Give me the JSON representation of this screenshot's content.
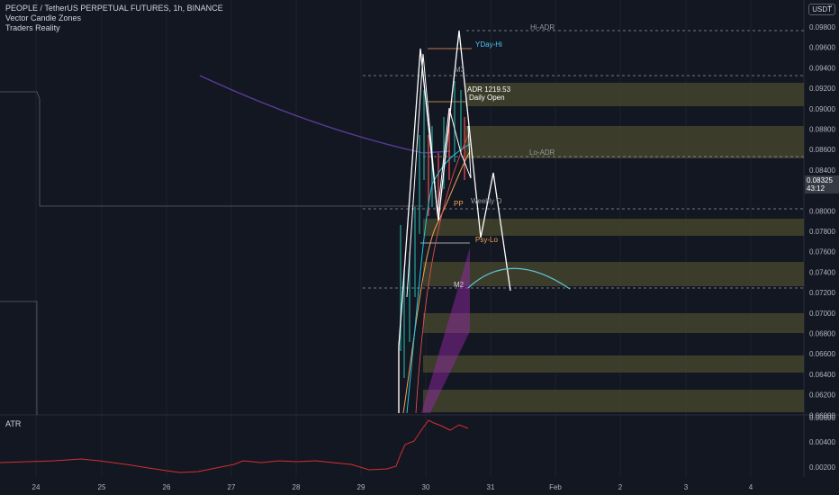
{
  "legend": {
    "symbol_line": "PEOPLE / TetherUS PERPETUAL FUTURES, 1h, BINANCE",
    "indicator_1": "Vector Candle Zones",
    "indicator_2": "Traders Reality"
  },
  "currency_button": "USDT",
  "current_price": {
    "value": "0.08325",
    "countdown": "43:12"
  },
  "price_axis": [
    "0.09800",
    "0.09600",
    "0.09400",
    "0.09200",
    "0.09000",
    "0.08800",
    "0.08600",
    "0.08400",
    "0.08200",
    "0.08000",
    "0.07800",
    "0.07600",
    "0.07400",
    "0.07200",
    "0.07000",
    "0.06800",
    "0.06600",
    "0.06400",
    "0.06200",
    "0.06000"
  ],
  "atr_panel": {
    "title": "ATR",
    "axis": [
      "0.00600",
      "0.00400",
      "0.00200"
    ]
  },
  "time_axis": [
    "24",
    "25",
    "26",
    "27",
    "28",
    "29",
    "30",
    "31",
    "Feb",
    "2",
    "3",
    "4"
  ],
  "level_labels": {
    "hi_adr": "Hi-ADR",
    "yday_hi": "YDay-Hi",
    "m3": "M3",
    "adr": "ADR 1219.53",
    "daily_open": "Daily Open",
    "lo_adr": "Lo-ADR",
    "pp": "PP",
    "weekly_open": "Weekly O",
    "psy_lo": "Psy-Lo",
    "m2": "M2"
  },
  "colors": {
    "background": "#131722",
    "zone_fill": "#4a4a2e",
    "ema_purple": "#5b3c9a",
    "forecast_line": "#ffffff",
    "arc": "#5fc4d9",
    "atr_line": "#d32f2f",
    "label_cyan": "#4fc3f7",
    "label_orange": "#f5a352"
  }
}
